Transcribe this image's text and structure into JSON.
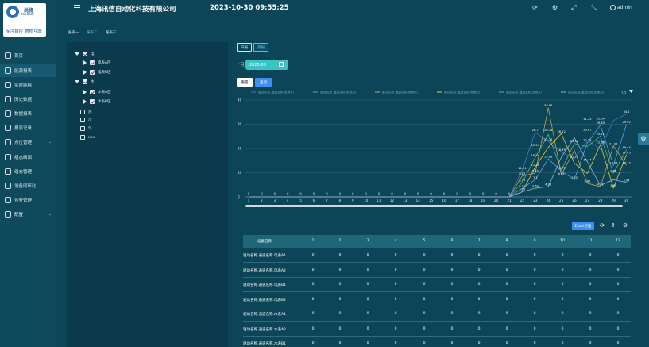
{
  "logo": {
    "cn": "尚修",
    "en": "sunfull",
    "slogan": "专注自控 物物互联"
  },
  "header": {
    "company": "上海讯信自动化科技有限公司",
    "datetime": "2023-10-30 09:55:25",
    "username": "admin"
  },
  "sidebar": {
    "items": [
      {
        "label": "首页"
      },
      {
        "label": "能源报表"
      },
      {
        "label": "实时能耗"
      },
      {
        "label": "历史数据"
      },
      {
        "label": "数据报表"
      },
      {
        "label": "报表记录"
      },
      {
        "label": "点位管理"
      },
      {
        "label": "组态画面"
      },
      {
        "label": "组态管理"
      },
      {
        "label": "设备同环比"
      },
      {
        "label": "告警管理"
      },
      {
        "label": "配置"
      }
    ]
  },
  "tabs": [
    "报表一",
    "报表二",
    "报表三"
  ],
  "tree": {
    "nodes": [
      {
        "label": "电"
      },
      {
        "label": "电表A区"
      },
      {
        "label": "电表B区"
      },
      {
        "label": "水"
      },
      {
        "label": "水表A区"
      },
      {
        "label": "水表B区"
      },
      {
        "label": "热"
      },
      {
        "label": "冷"
      },
      {
        "label": "气"
      },
      {
        "label": "xxx"
      }
    ]
  },
  "filter": {
    "btn_day": "日报",
    "btn_month": "月报",
    "month_label": "月:",
    "month_value": "2023-09",
    "btn_reset": "重置",
    "btn_query": "查询"
  },
  "chart_data": {
    "type": "line",
    "x": [
      1,
      2,
      3,
      4,
      5,
      6,
      7,
      8,
      9,
      10,
      11,
      12,
      13,
      14,
      15,
      16,
      17,
      18,
      19,
      20,
      21,
      22,
      23,
      24,
      25,
      26,
      27,
      28,
      29,
      30
    ],
    "ylim": [
      0,
      40
    ],
    "yticks": [
      0,
      10,
      20,
      30,
      40
    ],
    "page_indicator": "1/2",
    "series": [
      {
        "name": "驱动名称.通道名称.电表A1",
        "color": "#4d6fbf",
        "values": [
          0,
          0,
          0,
          0,
          0,
          0,
          0,
          0,
          0,
          0,
          0,
          0,
          0,
          0,
          0,
          0,
          0,
          0,
          0,
          0,
          0,
          11.01,
          26.7,
          22.78,
          18.59,
          15.73,
          23.25,
          19.88,
          31.54,
          34.2
        ]
      },
      {
        "name": "驱动名称.通道名称.电表A2",
        "color": "#57b37f",
        "values": [
          0,
          0,
          0,
          0,
          0,
          0,
          0,
          0,
          0,
          0,
          0,
          0,
          0,
          0,
          0,
          0,
          0,
          0,
          0,
          0,
          0,
          5.97,
          16.24,
          25.74,
          11.08,
          22.06,
          20.81,
          25.11,
          9.86,
          19.44
        ]
      },
      {
        "name": "驱动名称.通道名称.电表B1",
        "color": "#c7a24a",
        "values": [
          0,
          0,
          0,
          0,
          0,
          0,
          0,
          0,
          0,
          0,
          0,
          0,
          0,
          0,
          0,
          0,
          0,
          0,
          0,
          0,
          0,
          8.62,
          9.83,
          36.88,
          9.08,
          19.21,
          5.62,
          4.21,
          21.06,
          13.12
        ]
      },
      {
        "name": "驱动名称.通道名称.电表B2",
        "color": "#e6c84a",
        "values": [
          0,
          0,
          0,
          0,
          0,
          0,
          0,
          0,
          0,
          0,
          0,
          0,
          0,
          0,
          0,
          0,
          0,
          0,
          0,
          0,
          0,
          2.07,
          12.36,
          20.46,
          26.12,
          13.9,
          9.73,
          21.56,
          3.69,
          17.45
        ]
      },
      {
        "name": "驱动名称.通道名称.水表A1",
        "color": "#5aa0e6",
        "values": [
          0,
          0,
          0,
          0,
          0,
          0,
          0,
          0,
          0,
          0,
          0,
          0,
          0,
          0,
          0,
          0,
          0,
          0,
          0,
          0,
          0,
          3.52,
          7.1,
          15.68,
          10.76,
          7.12,
          22.3,
          29.63,
          13.07,
          29.92
        ]
      },
      {
        "name": "驱动名称.通道名称.水表A2",
        "color": "#8fb8d0",
        "values": [
          0,
          0,
          0,
          0,
          0,
          0,
          0,
          0,
          0,
          0,
          0,
          0,
          0,
          0,
          0,
          0,
          0,
          0,
          0,
          0,
          0,
          2.1,
          3.59,
          4.26,
          16.38,
          24.4,
          14.44,
          4.7,
          7.1,
          5.97
        ]
      }
    ],
    "data_labels": [
      {
        "x": 22,
        "text": "11.01"
      },
      {
        "x": 22,
        "text": "8.62"
      },
      {
        "x": 22,
        "text": "5.97"
      },
      {
        "x": 22,
        "text": "3.52"
      },
      {
        "x": 22,
        "text": "2.07"
      },
      {
        "x": 23,
        "text": "26.7"
      },
      {
        "x": 23,
        "text": "20.54"
      },
      {
        "x": 23,
        "text": "16.24"
      },
      {
        "x": 23,
        "text": "12.36"
      },
      {
        "x": 23,
        "text": "9.83"
      },
      {
        "x": 23,
        "text": "7.1"
      },
      {
        "x": 23,
        "text": "3.59"
      },
      {
        "x": 24,
        "text": "36.88"
      },
      {
        "x": 24,
        "text": "26.74"
      },
      {
        "x": 24,
        "text": "22.78"
      },
      {
        "x": 24,
        "text": "15.68"
      },
      {
        "x": 24,
        "text": "4.26"
      },
      {
        "x": 25,
        "text": "26.12"
      },
      {
        "x": 25,
        "text": "18.59"
      },
      {
        "x": 25,
        "text": "11.08"
      },
      {
        "x": 25,
        "text": "8.58"
      },
      {
        "x": 26,
        "text": "22.06"
      },
      {
        "x": 26,
        "text": "15.73"
      },
      {
        "x": 26,
        "text": "7.12"
      },
      {
        "x": 27,
        "text": "31.25"
      },
      {
        "x": 27,
        "text": "26.81"
      },
      {
        "x": 27,
        "text": "22.38"
      },
      {
        "x": 27,
        "text": "14.44"
      },
      {
        "x": 27,
        "text": "5.62"
      },
      {
        "x": 28,
        "text": "31.54"
      },
      {
        "x": 28,
        "text": "29.63"
      },
      {
        "x": 28,
        "text": "25.11"
      },
      {
        "x": 28,
        "text": "21.56"
      },
      {
        "x": 28,
        "text": "4.21"
      },
      {
        "x": 29,
        "text": "21.06"
      },
      {
        "x": 29,
        "text": "13.07"
      },
      {
        "x": 29,
        "text": "9.86"
      },
      {
        "x": 29,
        "text": "3.69"
      },
      {
        "x": 30,
        "text": "34.2"
      },
      {
        "x": 30,
        "text": "29.92"
      },
      {
        "x": 30,
        "text": "19.44"
      },
      {
        "x": 30,
        "text": "17.45"
      },
      {
        "x": 30,
        "text": "13.12"
      },
      {
        "x": 30,
        "text": "5.97"
      }
    ]
  },
  "table": {
    "export_label": "Excel导出",
    "headers": [
      "设备名称",
      "1",
      "2",
      "3",
      "4",
      "5",
      "6",
      "7",
      "8",
      "9",
      "10",
      "11",
      "12"
    ],
    "rows": [
      [
        "驱动名称.通道名称.电表A1",
        "0",
        "0",
        "0",
        "0",
        "0",
        "0",
        "0",
        "0",
        "0",
        "0",
        "0",
        "0"
      ],
      [
        "驱动名称.通道名称.电表A2",
        "0",
        "0",
        "0",
        "0",
        "0",
        "0",
        "0",
        "0",
        "0",
        "0",
        "0",
        "0"
      ],
      [
        "驱动名称.通道名称.电表B1",
        "0",
        "0",
        "0",
        "0",
        "0",
        "0",
        "0",
        "0",
        "0",
        "0",
        "0",
        "0"
      ],
      [
        "驱动名称.通道名称.电表B2",
        "0",
        "0",
        "0",
        "0",
        "0",
        "0",
        "0",
        "0",
        "0",
        "0",
        "0",
        "0"
      ],
      [
        "驱动名称.通道名称.水表A1",
        "0",
        "0",
        "0",
        "0",
        "0",
        "0",
        "0",
        "0",
        "0",
        "0",
        "0",
        "0"
      ],
      [
        "驱动名称.通道名称.水表A2",
        "0",
        "0",
        "0",
        "0",
        "0",
        "0",
        "0",
        "0",
        "0",
        "0",
        "0",
        "0"
      ],
      [
        "驱动名称.通道名称.水表B1",
        "0",
        "0",
        "0",
        "0",
        "0",
        "0",
        "0",
        "0",
        "0",
        "0",
        "0",
        "0"
      ]
    ]
  }
}
